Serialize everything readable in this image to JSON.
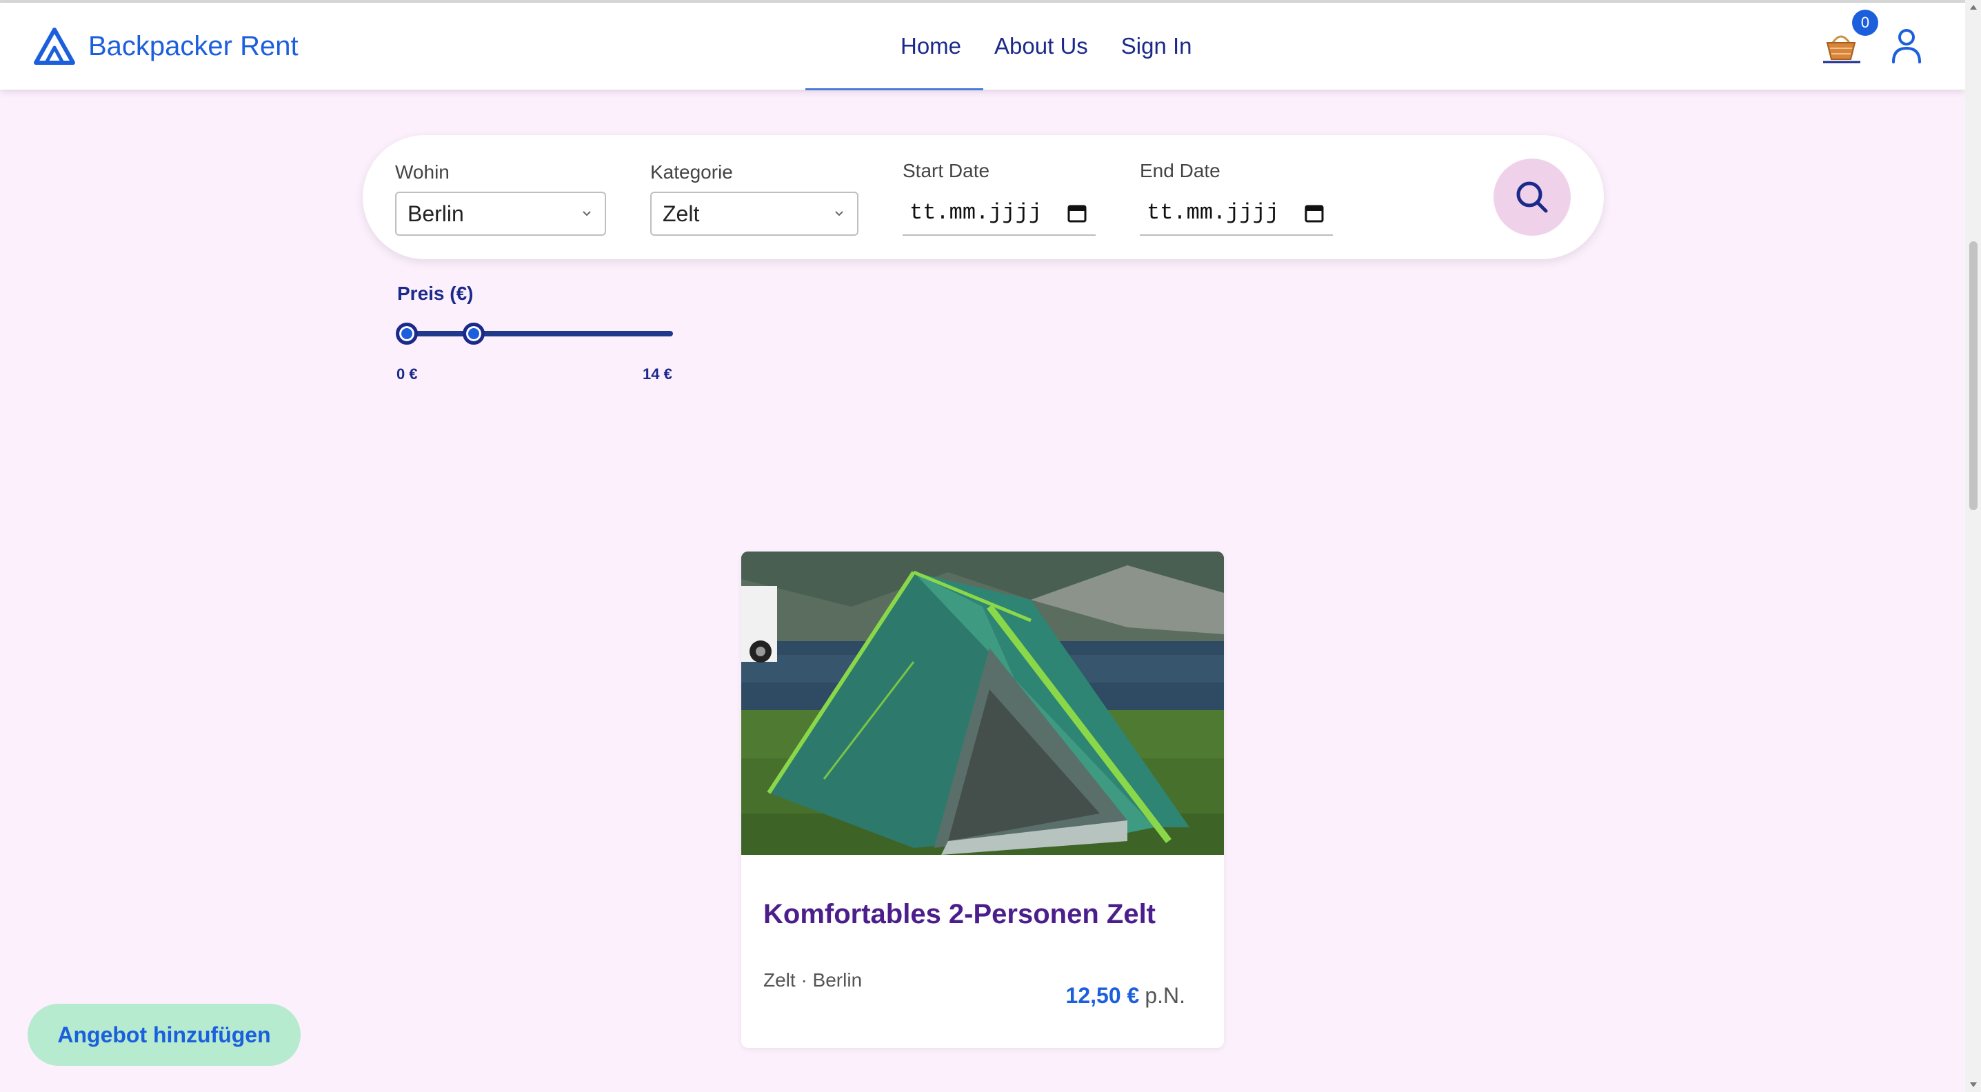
{
  "header": {
    "brand": "Backpacker Rent",
    "nav": [
      "Home",
      "About Us",
      "Sign In"
    ],
    "cart_count": "0"
  },
  "search": {
    "where_label": "Wohin",
    "where_value": "Berlin",
    "category_label": "Kategorie",
    "category_value": "Zelt",
    "start_label": "Start Date",
    "start_placeholder": "tt.mm.jjjj",
    "end_label": "End Date",
    "end_placeholder": "tt.mm.jjjj"
  },
  "price_filter": {
    "label": "Preis (€)",
    "min_label": "0 €",
    "max_label": "14 €",
    "min_value": 0,
    "max_value": 14,
    "low_thumb_value": 0,
    "high_thumb_value": 3.5
  },
  "listing": {
    "title": "Komfortables 2-Personen Zelt",
    "meta": "Zelt · Berlin",
    "price": "12,50 €",
    "price_unit": "p.N."
  },
  "actions": {
    "add_offer": "Angebot hinzufügen"
  },
  "colors": {
    "accent": "#1c5fdc",
    "nav": "#1b2a8a",
    "background": "#fdf0fd",
    "title": "#4b1e8c"
  },
  "icons": {
    "logo": "triangle-logo-icon",
    "cart": "basket-icon",
    "user": "user-icon",
    "search": "search-icon",
    "calendar": "calendar-icon"
  }
}
